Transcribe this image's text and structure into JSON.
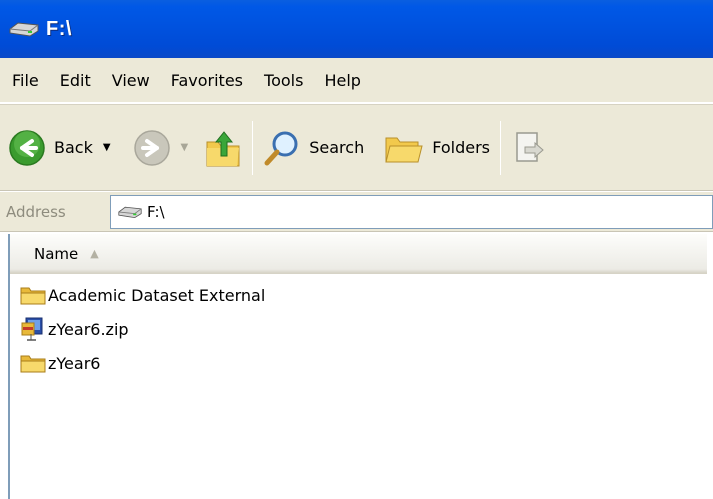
{
  "window": {
    "title": "F:\\"
  },
  "menu": {
    "items": [
      "File",
      "Edit",
      "View",
      "Favorites",
      "Tools",
      "Help"
    ]
  },
  "toolbar": {
    "back_label": "Back",
    "search_label": "Search",
    "folders_label": "Folders"
  },
  "address": {
    "label": "Address",
    "value": "F:\\"
  },
  "list": {
    "column_name": "Name",
    "items": [
      {
        "name": "Academic Dataset External",
        "icon": "folder-icon"
      },
      {
        "name": "zYear6.zip",
        "icon": "zip-file-icon"
      },
      {
        "name": "zYear6",
        "icon": "folder-icon"
      }
    ]
  },
  "colors": {
    "titlebar": "#0058e6",
    "chrome": "#ece9d8",
    "back_green": "#3a9b2e",
    "folder_yellow": "#f2c94c"
  }
}
